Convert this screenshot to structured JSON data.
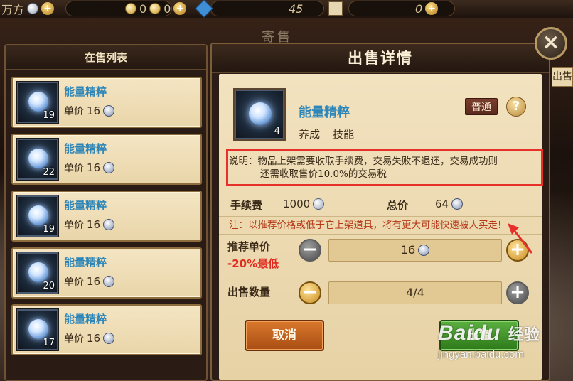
{
  "topbar": {
    "resource_a_text": "万方",
    "resource_b_value": "0",
    "resource_c_value": "0",
    "energy_value": "45",
    "gold_value": "0"
  },
  "ghost_title": "寄售",
  "list_panel": {
    "title": "在售列表",
    "price_label": "单价",
    "items": [
      {
        "name": "能量精粹",
        "count": "19",
        "price": "16"
      },
      {
        "name": "能量精粹",
        "count": "22",
        "price": "16"
      },
      {
        "name": "能量精粹",
        "count": "19",
        "price": "16"
      },
      {
        "name": "能量精粹",
        "count": "20",
        "price": "16"
      },
      {
        "name": "能量精粹",
        "count": "17",
        "price": "16"
      }
    ]
  },
  "detail": {
    "title": "出售详情",
    "item_name": "能量精粹",
    "item_count": "4",
    "tags": [
      "养成",
      "技能"
    ],
    "quality": "普通",
    "help": "?",
    "note_line1": "说明：物品上架需要收取手续费，交易失败不退还，交易成功则",
    "note_line2": "还需收取售价10.0%的交易税",
    "fee_label": "手续费",
    "fee_value": "1000",
    "total_label": "总价",
    "total_value": "64",
    "tip": "注：以推荐价格或低于它上架道具，将有更大可能快速被人买走!",
    "unit_price_label": "推荐单价",
    "unit_price_sub": "-20%最低",
    "unit_price_value": "16",
    "qty_label": "出售数量",
    "qty_value": "4/4",
    "cancel": "取消",
    "sell": "出售",
    "side_tab": "出售"
  },
  "watermark": {
    "brand": "Baidu",
    "cn": "经验",
    "url": "jingyan.baidu.com"
  },
  "colors": {
    "accent_red": "#e8302a",
    "item_blue": "#2e86b8",
    "cancel_orange": "#c8621e",
    "sell_green": "#48a030"
  }
}
